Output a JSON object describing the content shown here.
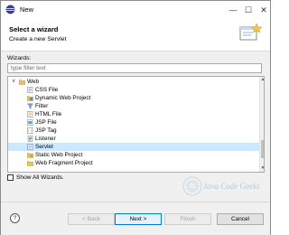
{
  "window": {
    "title": "New"
  },
  "header": {
    "title": "Select a wizard",
    "description": "Create a new Servlet"
  },
  "wizards": {
    "label": "Wizards:",
    "filter_placeholder": "type filter text",
    "items": [
      {
        "label": "Web",
        "icon": "folder-icon"
      },
      {
        "label": "CSS File",
        "icon": "css-file-icon"
      },
      {
        "label": "Dynamic Web Project",
        "icon": "web-project-icon"
      },
      {
        "label": "Filter",
        "icon": "filter-icon"
      },
      {
        "label": "HTML File",
        "icon": "html-file-icon"
      },
      {
        "label": "JSP File",
        "icon": "jsp-file-icon"
      },
      {
        "label": "JSP Tag",
        "icon": "jsp-tag-icon"
      },
      {
        "label": "Listener",
        "icon": "listener-icon"
      },
      {
        "label": "Servlet",
        "icon": "servlet-icon",
        "selected": true
      },
      {
        "label": "Static Web Project",
        "icon": "static-project-icon"
      },
      {
        "label": "Web Fragment Project",
        "icon": "fragment-project-icon"
      }
    ]
  },
  "show_all": {
    "label": "Show All Wizards.",
    "checked": false
  },
  "watermark": {
    "text": "Java Code Geeks"
  },
  "footer": {
    "help": "?",
    "back": "< Back",
    "next": "Next >",
    "finish": "Finish",
    "cancel": "Cancel"
  },
  "colors": {
    "selection": "#cce8ff",
    "accent": "#0078d7"
  }
}
